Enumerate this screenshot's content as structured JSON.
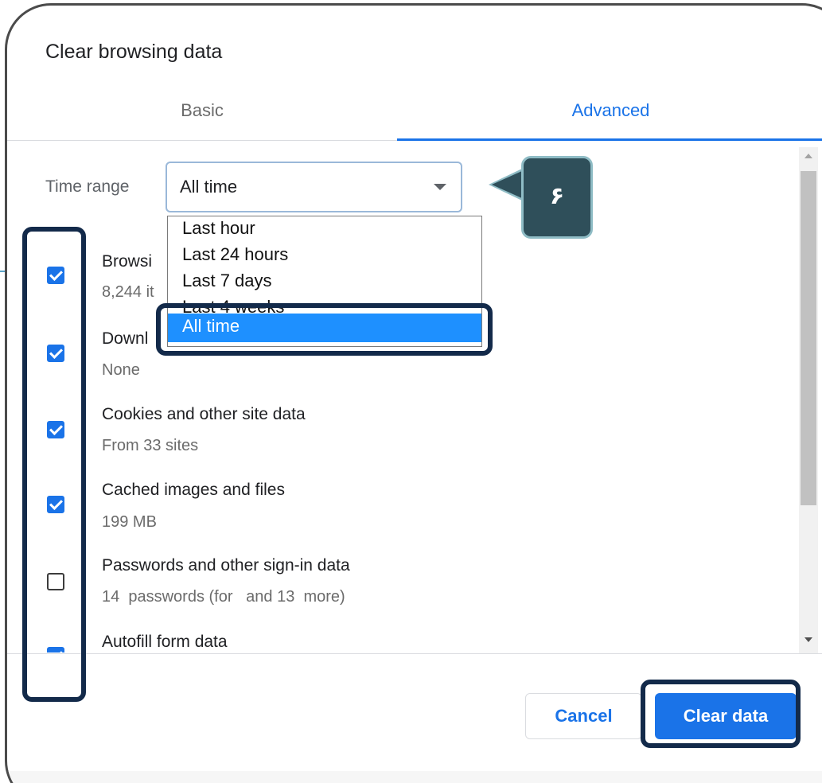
{
  "dialog": {
    "title": "Clear browsing data"
  },
  "tabs": [
    {
      "label": "Basic",
      "active": false
    },
    {
      "label": "Advanced",
      "active": true
    }
  ],
  "time_range": {
    "label": "Time range",
    "value": "All time",
    "options": [
      "Last hour",
      "Last 24 hours",
      "Last 7 days",
      "Last 4 weeks",
      "All time"
    ],
    "selected_option": "All time"
  },
  "items": [
    {
      "title": "Browsing history",
      "title_visible": "Browsi",
      "sub": "8,244 it",
      "checked": true
    },
    {
      "title": "Download history",
      "title_visible": "Downl",
      "sub": "None",
      "checked": true
    },
    {
      "title": "Cookies and other site data",
      "title_visible": "Cookies and other site data",
      "sub": "From 33 sites",
      "checked": true
    },
    {
      "title": "Cached images and files",
      "title_visible": "Cached images and files",
      "sub": "199 MB",
      "checked": true
    },
    {
      "title": "Passwords and other sign-in data",
      "title_visible": "Passwords and other sign-in data",
      "sub": "14  passwords (for   and 13  more)",
      "checked": false
    },
    {
      "title": "Autofill form data",
      "title_visible": "Autofill form data",
      "sub": "",
      "checked": true
    }
  ],
  "buttons": {
    "cancel": "Cancel",
    "clear": "Clear data"
  },
  "annotation": {
    "step_label": "۶"
  },
  "colors": {
    "accent": "#1a73e8",
    "highlight_border": "#132a4a",
    "callout_fill": "#2f4f5a",
    "dropdown_selected": "#1e90ff"
  }
}
